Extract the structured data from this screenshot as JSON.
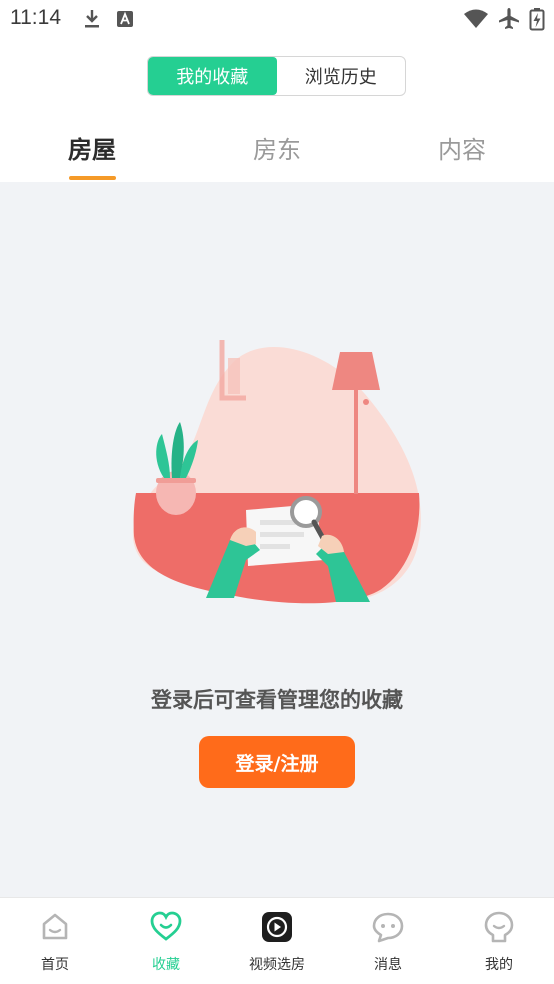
{
  "status_bar": {
    "time": "11:14",
    "icons": [
      "download-icon",
      "a-badge-icon",
      "wifi-icon",
      "airplane-icon",
      "battery-icon"
    ]
  },
  "segment": {
    "options": [
      "我的收藏",
      "浏览历史"
    ],
    "selected": "我的收藏",
    "accent_color": "#25cf92"
  },
  "tabs": {
    "items": [
      "房屋",
      "房东",
      "内容"
    ],
    "selected": "房屋",
    "underline_color": "#f59a28"
  },
  "empty_state": {
    "message": "登录后可查看管理您的收藏",
    "button_label": "登录/注册",
    "button_color": "#ff6b1a"
  },
  "bottom_nav": {
    "items": [
      {
        "label": "首页",
        "icon": "home-face-icon"
      },
      {
        "label": "收藏",
        "icon": "heart-icon"
      },
      {
        "label": "视频选房",
        "icon": "video-play-icon"
      },
      {
        "label": "消息",
        "icon": "chat-bubble-icon"
      },
      {
        "label": "我的",
        "icon": "profile-face-icon"
      }
    ],
    "selected": "收藏"
  }
}
